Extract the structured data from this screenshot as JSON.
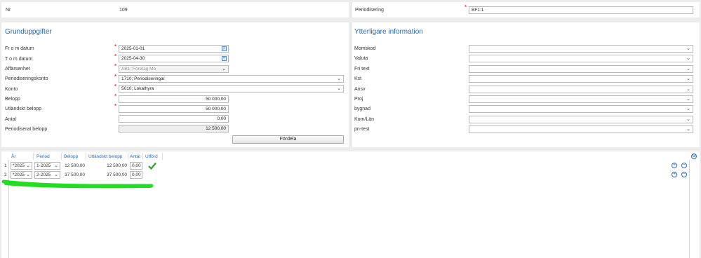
{
  "header": {
    "nr_label": "Nr",
    "nr_value": "109",
    "periodisering_label": "Periodisering",
    "periodisering_value": "BF1:1"
  },
  "grund": {
    "title": "Grunduppgifter",
    "from_label": "Fr o m datum",
    "from_value": "2025-01-01",
    "tom_label": "T o m datum",
    "tom_value": "2025-04-30",
    "affar_label": "Affärsenhet",
    "affar_value": "AB1; Företag Mö",
    "perkonto_label": "Periodiseringskonto",
    "perkonto_value": "1710; Periodiseringar",
    "konto_label": "Konto",
    "konto_value": "5010; Lokalhyra",
    "belopp_label": "Belopp",
    "belopp_value": "50 000,00",
    "utl_label": "Utländskt belopp",
    "utl_value": "50 000,00",
    "antal_label": "Antal",
    "antal_value": "0,00",
    "perbelopp_label": "Periodiserat belopp",
    "perbelopp_value": "12 500,00",
    "fordela_label": "Fördela"
  },
  "ytter": {
    "title": "Ytterligare information",
    "fields": [
      "Momskod",
      "Valuta",
      "Fri text",
      "Kst",
      "Ansv",
      "Proj",
      "bygnad",
      "Kom/Län",
      "pn-test"
    ]
  },
  "grid": {
    "headers": {
      "ar": "År",
      "period": "Period",
      "belopp": "Belopp",
      "utl": "Utländskt belopp",
      "antal": "Antal",
      "utford": "Utförd"
    },
    "rows": [
      {
        "num": "1",
        "ar": "*2025",
        "period": "1-2025",
        "belopp": "12 500,00",
        "utl": "12 500,00",
        "antal": "0,00",
        "utford": true
      },
      {
        "num": "2",
        "ar": "*2025",
        "period": "2-2025",
        "belopp": "37 500,00",
        "utl": "37 500,00",
        "antal": "0,00",
        "utford": false
      }
    ]
  },
  "colors": {
    "accent": "#2a6aad",
    "required": "#cc0000",
    "highlight": "#22dd22",
    "check": "#3a9a2a"
  }
}
